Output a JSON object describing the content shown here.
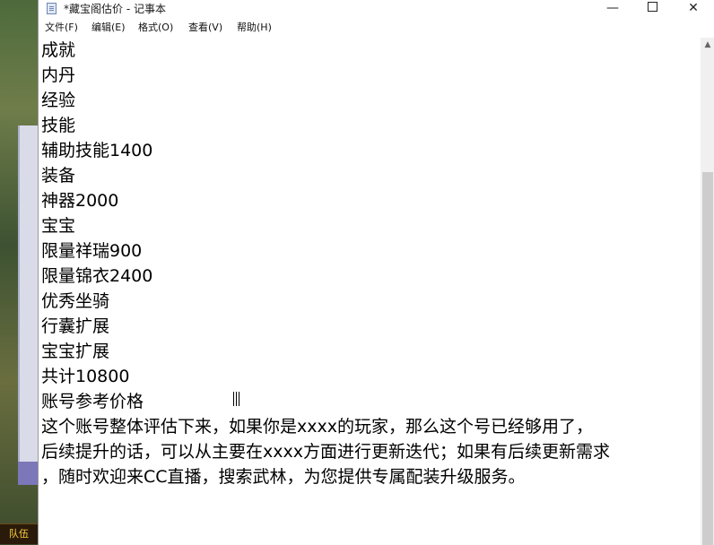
{
  "window": {
    "title": "*藏宝阁估价 - 记事本",
    "minimize_glyph": "—",
    "close_glyph": "✕"
  },
  "menu": [
    "文件(F)",
    "编辑(E)",
    "格式(O)",
    "查看(V)",
    "帮助(H)"
  ],
  "editor": {
    "lines": [
      "成就",
      "内丹",
      "经验",
      "技能",
      "辅助技能1400",
      "装备",
      "神器2000",
      "宝宝",
      "限量祥瑞900",
      "限量锦衣2400",
      "优秀坐骑",
      "行囊扩展",
      "宝宝扩展",
      "共计10800",
      "账号参考价格",
      "这个账号整体评估下来，如果你是xxxx的玩家，那么这个号已经够用了，",
      "后续提升的话，可以从主要在xxxx方面进行更新迭代；如果有后续更新需求",
      "，随时欢迎来CC直播，搜索武林，为您提供专属配装升级服务。"
    ]
  },
  "background": {
    "team_badge": "队伍"
  },
  "icons": {
    "app": "notepad-icon",
    "scroll_up": "chevron-up-icon",
    "cursor": "text-cursor-icon"
  }
}
